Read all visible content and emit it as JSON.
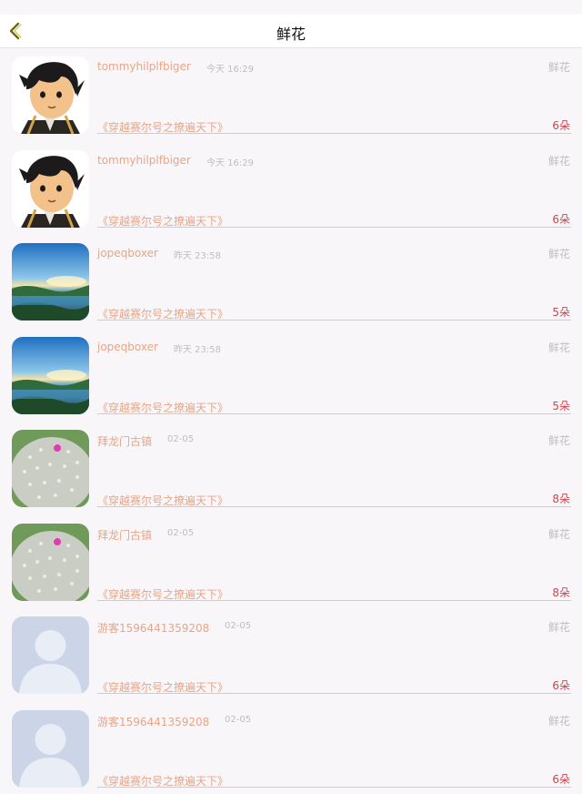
{
  "nav": {
    "title": "鲜花"
  },
  "items": [
    {
      "user": "tommyhilplfbiger",
      "time": "今天 16:29",
      "type": "鲜花",
      "book": "《穿越赛尔号之撩遍天下》",
      "count": "6朵",
      "avatar": "anime"
    },
    {
      "user": "tommyhilplfbiger",
      "time": "今天 16:29",
      "type": "鲜花",
      "book": "《穿越赛尔号之撩遍天下》",
      "count": "6朵",
      "avatar": "anime"
    },
    {
      "user": "jopeqboxer",
      "time": "昨天 23:58",
      "type": "鲜花",
      "book": "《穿越赛尔号之撩遍天下》",
      "count": "5朵",
      "avatar": "landscape"
    },
    {
      "user": "jopeqboxer",
      "time": "昨天 23:58",
      "type": "鲜花",
      "book": "《穿越赛尔号之撩遍天下》",
      "count": "5朵",
      "avatar": "landscape"
    },
    {
      "user": "拜龙门古镇",
      "time": "02-05",
      "type": "鲜花",
      "book": "《穿越赛尔号之撩遍天下》",
      "count": "8朵",
      "avatar": "cactus"
    },
    {
      "user": "拜龙门古镇",
      "time": "02-05",
      "type": "鲜花",
      "book": "《穿越赛尔号之撩遍天下》",
      "count": "8朵",
      "avatar": "cactus"
    },
    {
      "user": "游客1596441359208",
      "time": "02-05",
      "type": "鲜花",
      "book": "《穿越赛尔号之撩遍天下》",
      "count": "6朵",
      "avatar": "default"
    },
    {
      "user": "游客1596441359208",
      "time": "02-05",
      "type": "鲜花",
      "book": "《穿越赛尔号之撩遍天下》",
      "count": "6朵",
      "avatar": "default"
    }
  ]
}
